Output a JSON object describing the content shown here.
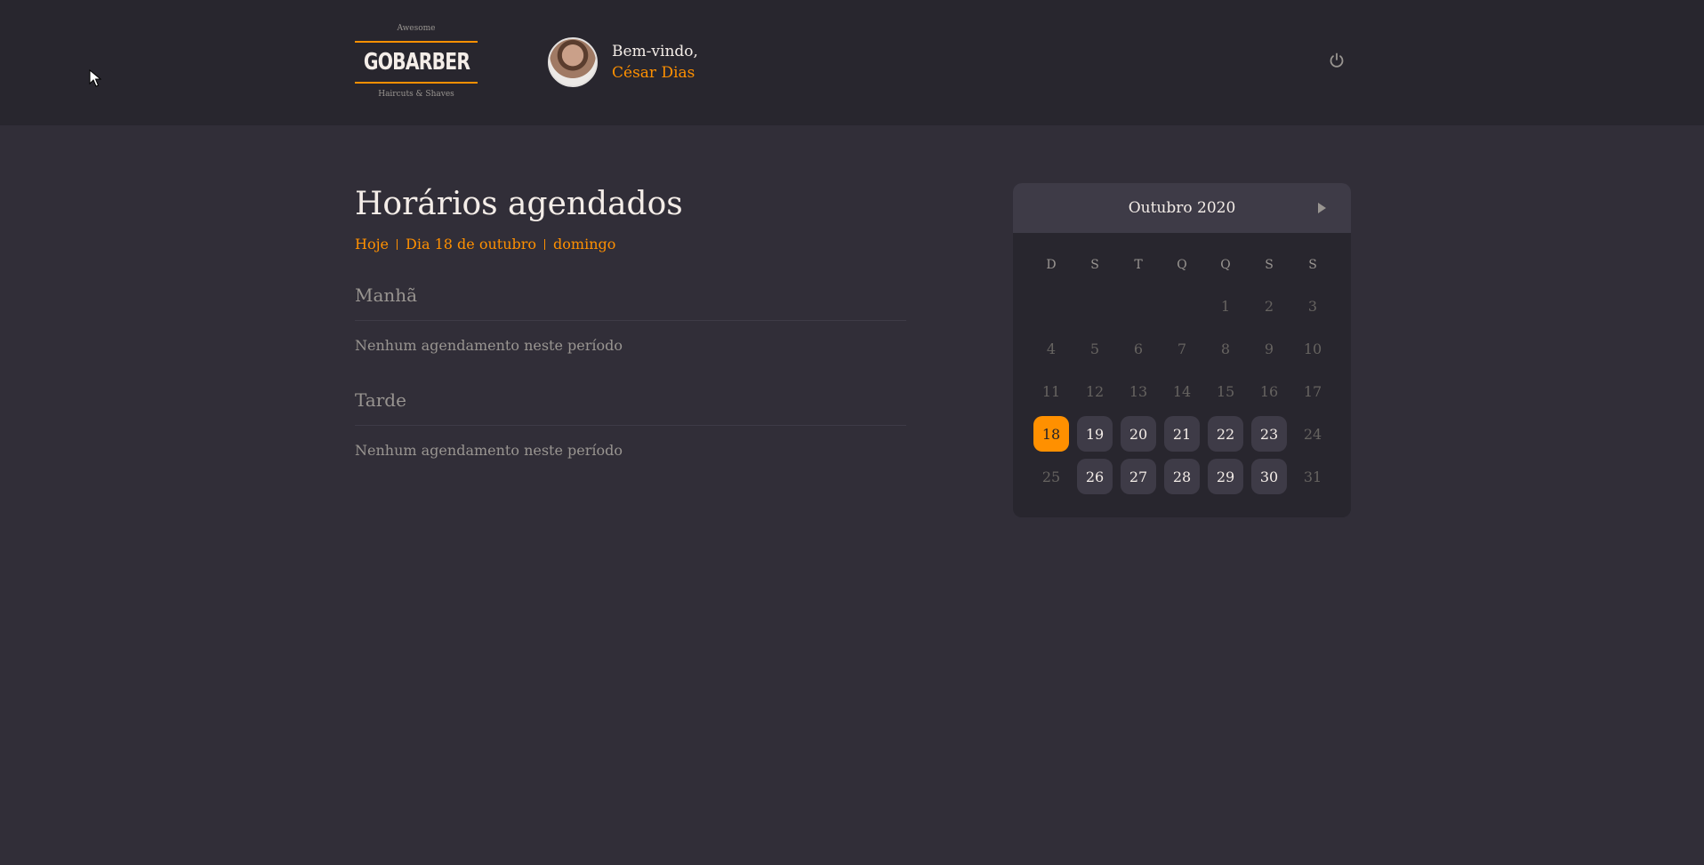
{
  "header": {
    "logo": {
      "top": "Awesome",
      "mark": "GOBARBER",
      "bottom": "Haircuts & Shaves"
    },
    "profile": {
      "greeting": "Bem-vindo,",
      "name": "César Dias"
    },
    "logout_icon": "power-icon"
  },
  "main": {
    "title": "Horários agendados",
    "subtitle": {
      "today": "Hoje",
      "date": "Dia 18 de outubro",
      "weekday": "domingo"
    },
    "sections": [
      {
        "title": "Manhã",
        "empty": "Nenhum agendamento neste período"
      },
      {
        "title": "Tarde",
        "empty": "Nenhum agendamento neste período"
      }
    ]
  },
  "calendar": {
    "month": "Outubro 2020",
    "weekdays": [
      "D",
      "S",
      "T",
      "Q",
      "Q",
      "S",
      "S"
    ],
    "first_weekday": 4,
    "days_in_month": 31,
    "selected_day": 18,
    "available_days": [
      19,
      20,
      21,
      22,
      23,
      26,
      27,
      28,
      29,
      30
    ],
    "accent_color": "#ff9000"
  }
}
